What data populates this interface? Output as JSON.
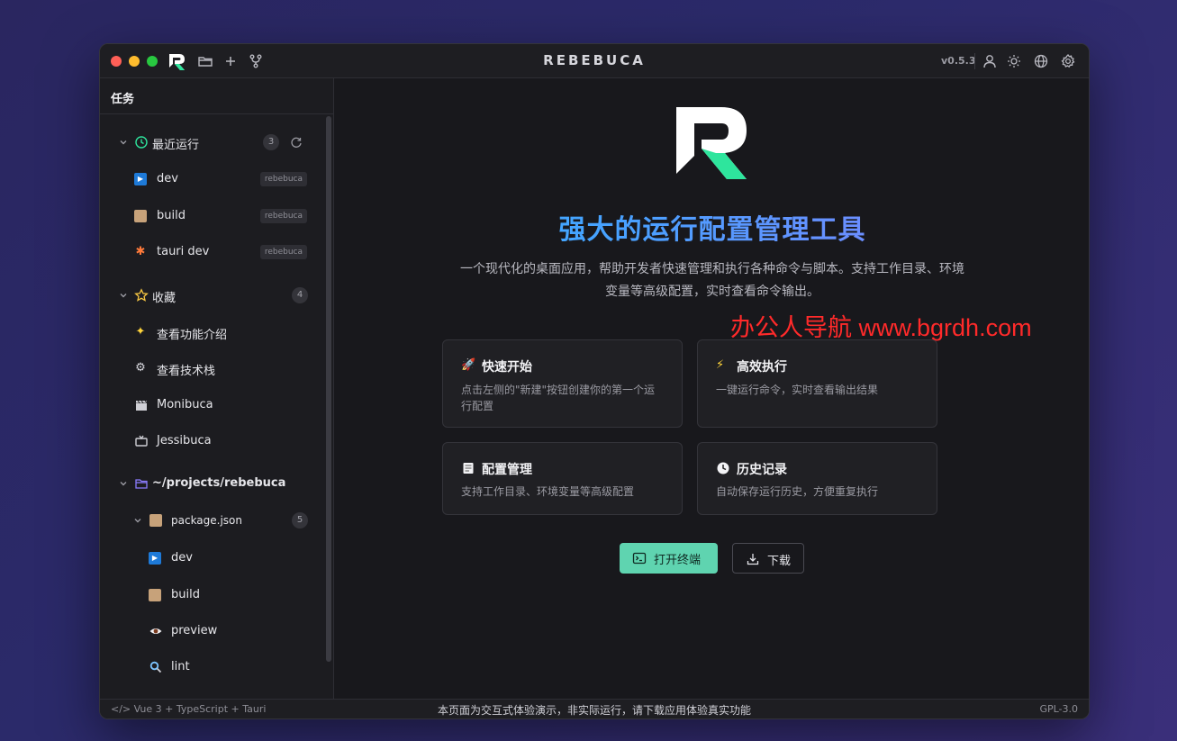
{
  "titlebar": {
    "brand": "REBEBUCA",
    "version": "v0.5.3"
  },
  "sidebar": {
    "header": "任务",
    "recent": {
      "label": "最近运行",
      "count": "3",
      "items": [
        {
          "label": "dev",
          "tag": "rebebuca"
        },
        {
          "label": "build",
          "tag": "rebebuca"
        },
        {
          "label": "tauri dev",
          "tag": "rebebuca"
        }
      ]
    },
    "favorites": {
      "label": "收藏",
      "count": "4",
      "items": [
        {
          "label": "查看功能介绍"
        },
        {
          "label": "查看技术栈"
        },
        {
          "label": "Monibuca"
        },
        {
          "label": "Jessibuca"
        }
      ]
    },
    "project": {
      "label": "~/projects/rebebuca",
      "package": {
        "label": "package.json",
        "count": "5",
        "items": [
          {
            "label": "dev"
          },
          {
            "label": "build"
          },
          {
            "label": "preview"
          },
          {
            "label": "lint"
          }
        ]
      }
    }
  },
  "main": {
    "title": "强大的运行配置管理工具",
    "subtitle_line1": "一个现代化的桌面应用，帮助开发者快速管理和执行各种命令与脚本。支持工作目录、环境",
    "subtitle_line2": "变量等高级配置，实时查看命令输出。",
    "watermark": "办公人导航  www.bgrdh.com",
    "cards": [
      {
        "title": "快速开始",
        "desc": "点击左侧的\"新建\"按钮创建你的第一个运行配置"
      },
      {
        "title": "高效执行",
        "desc": "一键运行命令，实时查看输出结果"
      },
      {
        "title": "配置管理",
        "desc": "支持工作目录、环境变量等高级配置"
      },
      {
        "title": "历史记录",
        "desc": "自动保存运行历史，方便重复执行"
      }
    ],
    "open_terminal": "打开终端",
    "download": "下载"
  },
  "statusbar": {
    "left": "</> Vue 3 + TypeScript + Tauri",
    "center": "本页面为交互式体验演示，非实际运行，请下载应用体验真实功能",
    "right": "GPL-3.0"
  },
  "colors": {
    "accent": "#5fd4b0",
    "title_gradient_start": "#2fb5ff",
    "title_gradient_end": "#8b7cff"
  }
}
